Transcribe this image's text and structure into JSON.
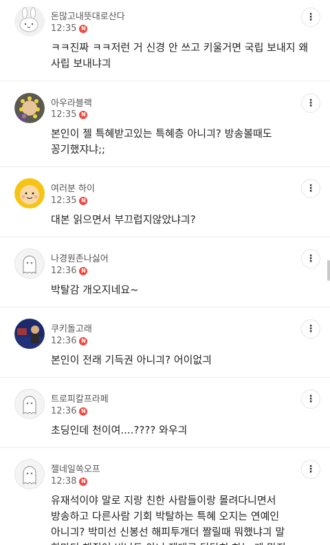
{
  "comments": [
    {
      "nickname": "돈많고내뜻대로산다",
      "time": "12:35",
      "badge": "N",
      "avatar": "bunny-avatar-icon",
      "text": "ㅋㅋ진짜 ㅋㅋ저런 거 신경 안 쓰고 키울거면 국립 보내지 왜\n사립 보내냐긔"
    },
    {
      "nickname": "아우라블랙",
      "time": "12:35",
      "badge": "N",
      "avatar": "photo-avatar-flowers",
      "text": "본인이 젤 특혜받고있는 특혜층 아니긔? 방송볼때도\n꽁기했쟈냐;;"
    },
    {
      "nickname": "여러분 하이",
      "time": "12:35",
      "badge": "N",
      "avatar": "yellow-character-avatar",
      "text": "대본 읽으면서 부끄럽지않았냐긔?"
    },
    {
      "nickname": "나경원존나싫어",
      "time": "12:36",
      "badge": "N",
      "avatar": "default-ghost-avatar-icon",
      "text": "박탈감 개오지네요~"
    },
    {
      "nickname": "쿠키돌고래",
      "time": "12:36",
      "badge": "N",
      "avatar": "photo-avatar-news",
      "avatar_text": "대한민국\n검무부",
      "text": "본인이 전래 기득권 아니긔? 어이없긔"
    },
    {
      "nickname": "트로피칼프라페",
      "time": "12:36",
      "badge": "N",
      "avatar": "default-ghost-avatar-icon",
      "text": "초딩인데 천이여....???? 와우긔"
    },
    {
      "nickname": "젤네일쏙오프",
      "time": "12:38",
      "badge": "N",
      "avatar": "default-ghost-avatar-icon",
      "text": "유재석이야 말로 지랑 친한 사람들이랑 몰려다니면서\n방송하고 다른사람 기회 박탈하는 특혜 오지는 연예인\n아니긔? 박미선 신봉선 해피투개더 짤릴때 뭐했냐긔 말\n한마디 해줬어 비난도 아니 제대로 당당히 하는 게 맞지"
    }
  ],
  "more_icon": "more-vertical-icon",
  "colors": {
    "badge": "#f2453d",
    "divider": "#ececec"
  }
}
